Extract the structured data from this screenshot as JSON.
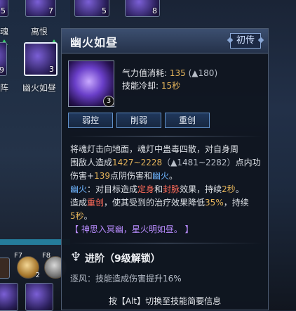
{
  "skill_bar": {
    "slots": [
      {
        "label": "魂",
        "count": "5"
      },
      {
        "label": "离恨",
        "count": "7"
      },
      {
        "label": "",
        "count": "5"
      },
      {
        "label": "",
        "count": "8"
      },
      {
        "label": "",
        "count": "9"
      },
      {
        "label": "阵",
        "count": ""
      },
      {
        "label": "幽火如昼",
        "count": "3"
      }
    ],
    "hotkeys": [
      "F7",
      "F8"
    ],
    "items": [
      {
        "count": "2"
      },
      {
        "count": ""
      }
    ]
  },
  "tooltip": {
    "title": "幽火如昼",
    "rank": "初传",
    "skill_level": "3",
    "stats": {
      "cost_label": "气力值消耗:",
      "cost_value": "135",
      "cost_next": "180",
      "cooldown_label": "技能冷却:",
      "cooldown_value": "15秒"
    },
    "tags": [
      "弱控",
      "削弱",
      "重创"
    ],
    "desc": {
      "l1": "将魂灯击向地面，魂灯中蛊毒四散，对自身周",
      "l2a": "围敌人造成",
      "l2b": "1427~2228",
      "l2c": "1481~2282",
      "l2d": "点内功",
      "l3a": "伤害+",
      "l3b": "139",
      "l3c": "点阴伤害和",
      "l3d": "幽火",
      "l3e": "。",
      "l4a": "幽火",
      "l4b": "：对目标造成",
      "l4c": "定身",
      "l4d": "和",
      "l4e": "封脉",
      "l4f": "效果，持续",
      "l4g": "2秒",
      "l4h": "。",
      "l5a": "造成",
      "l5b": "重创",
      "l5c": "，使其受到的治疗效果降低",
      "l5d": "35%",
      "l5e": "，持续",
      "l6a": "5秒",
      "l6b": "。",
      "l7": "【 神思入冥幽，星火明如昼。 】"
    },
    "advance": {
      "title": "进阶（9级解锁）",
      "desc": "逐风：技能造成伤害提升16%"
    },
    "hint": "按【Alt】切换至技能简要信息"
  }
}
